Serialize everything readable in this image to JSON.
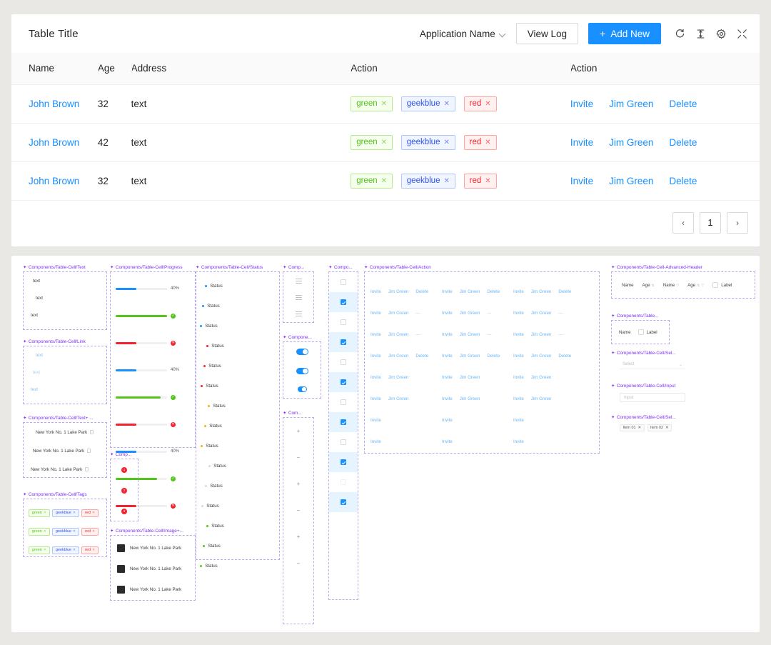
{
  "table_card": {
    "title": "Table Title",
    "toolbar": {
      "app_select_label": "Application Name",
      "view_log_label": "View Log",
      "add_new_label": "Add New",
      "add_new_plus": "+",
      "icons": [
        "reload-icon",
        "column-height-icon",
        "settings-icon",
        "fullscreen-icon"
      ]
    },
    "columns": [
      "Name",
      "Age",
      "Address",
      "Action",
      "Action"
    ],
    "rows": [
      {
        "name": "John Brown",
        "age": "32",
        "address": "text",
        "tags": [
          {
            "label": "green",
            "type": "green"
          },
          {
            "label": "geekblue",
            "type": "geekblue"
          },
          {
            "label": "red",
            "type": "red"
          }
        ],
        "actions": [
          "Invite",
          "Jim Green",
          "Delete"
        ]
      },
      {
        "name": "John Brown",
        "age": "42",
        "address": "text",
        "tags": [
          {
            "label": "green",
            "type": "green"
          },
          {
            "label": "geekblue",
            "type": "geekblue"
          },
          {
            "label": "red",
            "type": "red"
          }
        ],
        "actions": [
          "Invite",
          "Jim Green",
          "Delete"
        ]
      },
      {
        "name": "John Brown",
        "age": "32",
        "address": "text",
        "tags": [
          {
            "label": "green",
            "type": "green"
          },
          {
            "label": "geekblue",
            "type": "geekblue"
          },
          {
            "label": "red",
            "type": "red"
          }
        ],
        "actions": [
          "Invite",
          "Jim Green",
          "Delete"
        ]
      }
    ],
    "pagination": {
      "prev": "‹",
      "current": "1",
      "next": "›"
    }
  },
  "canvas": {
    "frames": {
      "text": {
        "label": "Components/Table-Cell/Text",
        "cells": [
          "text",
          "text",
          "text"
        ]
      },
      "link": {
        "label": "Components/Table-Cell/Link",
        "cells": [
          "text",
          "text",
          "text"
        ]
      },
      "text_plus": {
        "label": "Components/Table-Cell/Text+ ...",
        "cells": [
          "New York No. 1 Lake Park",
          "New York No. 1 Lake Park",
          "New York No. 1 Lake Park"
        ]
      },
      "tags": {
        "label": "Components/Table-Cell/Tags",
        "rows": [
          [
            {
              "label": "green",
              "type": "green"
            },
            {
              "label": "geekblue",
              "type": "geekblue"
            },
            {
              "label": "red",
              "type": "red"
            }
          ],
          [
            {
              "label": "green",
              "type": "green"
            },
            {
              "label": "geekblue",
              "type": "geekblue"
            },
            {
              "label": "red",
              "type": "red"
            }
          ],
          [
            {
              "label": "green",
              "type": "green"
            },
            {
              "label": "geekblue",
              "type": "geekblue"
            },
            {
              "label": "red",
              "type": "red"
            }
          ]
        ]
      },
      "progress": {
        "label": "Components/Table-Cell/Progress",
        "bars": [
          {
            "percent": 40,
            "color": "#1890ff",
            "value_label": "40%",
            "end": "label"
          },
          {
            "percent": 100,
            "color": "#52c41a",
            "value_label": "",
            "end": "success"
          },
          {
            "percent": 40,
            "color": "#f5222d",
            "value_label": "",
            "end": "error"
          },
          {
            "percent": 40,
            "color": "#1890ff",
            "value_label": "40%",
            "end": "label"
          },
          {
            "percent": 88,
            "color": "#52c41a",
            "value_label": "",
            "end": "success"
          },
          {
            "percent": 40,
            "color": "#f5222d",
            "value_label": "",
            "end": "error"
          },
          {
            "percent": 40,
            "color": "#1890ff",
            "value_label": "40%",
            "end": "label"
          },
          {
            "percent": 80,
            "color": "#52c41a",
            "value_label": "",
            "end": "success"
          },
          {
            "percent": 40,
            "color": "#f5222d",
            "value_label": "",
            "end": "error"
          }
        ]
      },
      "badge": {
        "label": "Comp...",
        "dots": [
          "1",
          "2",
          "3"
        ]
      },
      "image_text": {
        "label": "Components/Table-Cell/Image+...",
        "rows": [
          "New York No. 1 Lake Park",
          "New York No. 1 Lake Park",
          "New York No. 1 Lake Park"
        ]
      },
      "status": {
        "label": "Components/Table-Cell/Status",
        "items": [
          {
            "text": "Status",
            "color": "#1890ff",
            "indent": 12
          },
          {
            "text": "Status",
            "color": "#1890ff",
            "indent": 8
          },
          {
            "text": "Status",
            "color": "#1890ff",
            "indent": 5
          },
          {
            "text": "Status",
            "color": "#f5222d",
            "indent": 14
          },
          {
            "text": "Status",
            "color": "#f5222d",
            "indent": 10
          },
          {
            "text": "Status",
            "color": "#f5222d",
            "indent": 6
          },
          {
            "text": "Status",
            "color": "#faad14",
            "indent": 16
          },
          {
            "text": "Status",
            "color": "#faad14",
            "indent": 11
          },
          {
            "text": "Status",
            "color": "#faad14",
            "indent": 6
          },
          {
            "text": "Status",
            "color": "#d9d9d9",
            "indent": 17
          },
          {
            "text": "Status",
            "color": "#d9d9d9",
            "indent": 12
          },
          {
            "text": "Status",
            "color": "#d9d9d9",
            "indent": 7
          },
          {
            "text": "Status",
            "color": "#52c41a",
            "indent": 14
          },
          {
            "text": "Status",
            "color": "#52c41a",
            "indent": 9
          },
          {
            "text": "Status",
            "color": "#52c41a",
            "indent": 5
          }
        ]
      },
      "drag": {
        "label": "Comp...",
        "handles": 3
      },
      "switch": {
        "label": "Compone...",
        "states": [
          true,
          true,
          true
        ]
      },
      "stepper": {
        "label": "Com...",
        "groups": [
          [
            "+",
            "−"
          ],
          [
            "+",
            "−"
          ],
          [
            "+",
            "−"
          ]
        ]
      },
      "checkbox": {
        "label": "Compo...",
        "rows": [
          false,
          true,
          false,
          true,
          false,
          true,
          false,
          true,
          false,
          true,
          "ghost",
          true
        ]
      },
      "action": {
        "label": "Components/Table-Cell/Action",
        "grid": [
          [
            "Invite",
            "Jim Green",
            "Delete"
          ],
          [
            "Invite",
            "Jim Green",
            "—"
          ],
          [
            "Invite",
            "Jim Green",
            "—"
          ],
          [
            "Invite",
            "Jim Green",
            "Delete"
          ],
          [
            "Invite",
            "Jim Green",
            ""
          ],
          [
            "Invite",
            "Jim Green",
            ""
          ],
          [
            "Invite",
            "",
            ""
          ],
          [
            "Invite",
            "",
            ""
          ]
        ],
        "columns": 3
      },
      "advanced_header": {
        "label": "Components/Table-Cell-Advanced-Header",
        "items": [
          {
            "text": "Name",
            "sort": false,
            "filter": false,
            "checkbox": false
          },
          {
            "text": "Age",
            "sort": true,
            "filter": false,
            "checkbox": false
          },
          {
            "text": "Name",
            "sort": false,
            "filter": true,
            "checkbox": false
          },
          {
            "text": "Age",
            "sort": true,
            "filter": true,
            "checkbox": false
          },
          {
            "text": "Label",
            "sort": false,
            "filter": false,
            "checkbox": true
          }
        ]
      },
      "header_simple": {
        "label": "Components/Table...",
        "items": [
          {
            "text": "Name"
          },
          {
            "text": "Label",
            "checkbox": true
          }
        ]
      },
      "select": {
        "label": "Components/Table-Cell/Sel...",
        "placeholder": "Select"
      },
      "input": {
        "label": "Components/Table-Cell/Input",
        "placeholder": "Input"
      },
      "multiselect": {
        "label": "Components/Table-Cell/Sel...",
        "tags": [
          "Item 01",
          "Item 02"
        ]
      }
    }
  }
}
